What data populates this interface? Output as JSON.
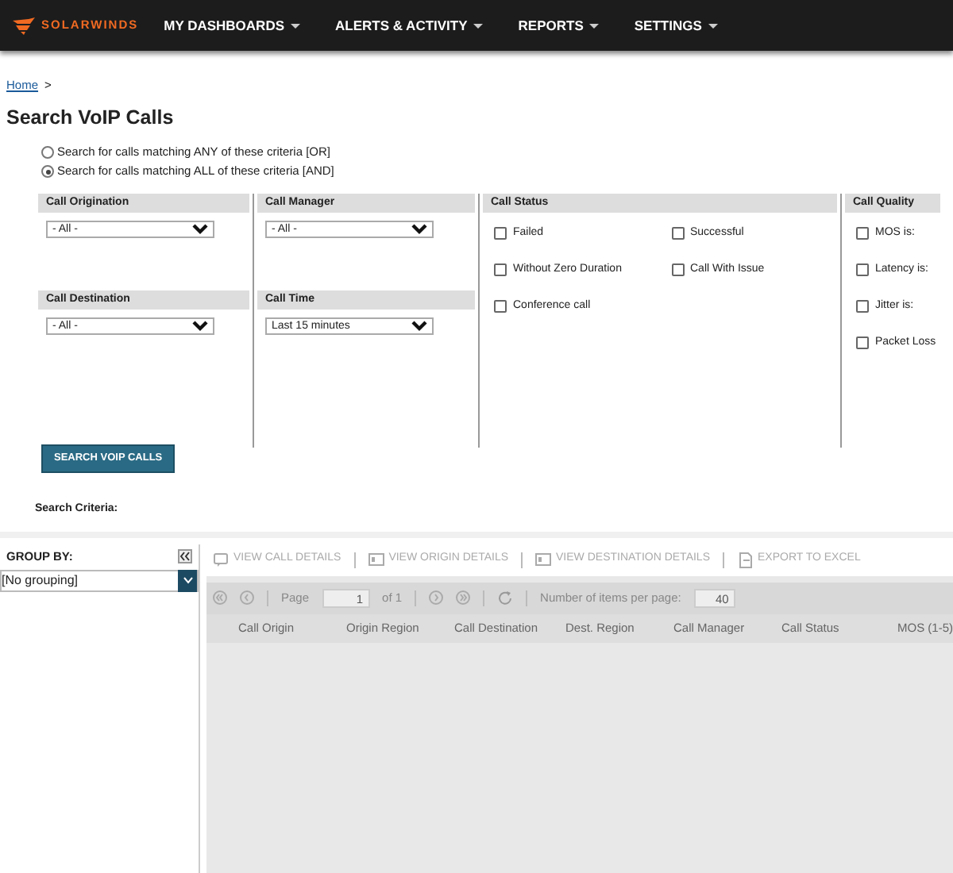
{
  "nav": {
    "logo": "SOLARWINDS",
    "items": [
      {
        "label": "MY DASHBOARDS"
      },
      {
        "label": "ALERTS & ACTIVITY"
      },
      {
        "label": "REPORTS"
      },
      {
        "label": "SETTINGS"
      }
    ]
  },
  "breadcrumb": {
    "link": "Home",
    "separator": ">"
  },
  "title": "Search VoIP Calls",
  "match_mode": [
    {
      "label": "Search for calls matching ANY of these criteria [OR]",
      "selected": false
    },
    {
      "label": "Search for calls matching ALL of these criteria [AND]",
      "selected": true
    }
  ],
  "criteria": [
    {
      "kind": "selects",
      "fields": [
        {
          "label": "Call Origination",
          "value": "- All -"
        },
        {
          "label": "Call Destination",
          "value": "- All -"
        }
      ]
    },
    {
      "kind": "selects",
      "fields": [
        {
          "label": "Call Manager",
          "value": "- All -"
        },
        {
          "label": "Call Time",
          "value": "Last 15 minutes"
        }
      ]
    },
    {
      "kind": "checks",
      "title": "Call Status",
      "items": [
        {
          "label": "Failed",
          "checked": false
        },
        {
          "label": "Successful",
          "checked": false
        },
        {
          "label": "Without Zero Duration",
          "checked": false
        },
        {
          "label": "Call With Issue",
          "checked": false
        },
        {
          "label": "Conference call",
          "checked": false
        }
      ]
    },
    {
      "kind": "checks",
      "title": "Call Quality",
      "items": [
        {
          "label": "MOS is:",
          "checked": false
        },
        {
          "label": "Latency is:",
          "checked": false
        },
        {
          "label": "Jitter is:",
          "checked": false
        },
        {
          "label": "Packet Loss",
          "checked": false
        }
      ]
    }
  ],
  "search_button": "SEARCH VOIP CALLS",
  "search_criteria_label": "Search Criteria:",
  "group_by": {
    "label": "GROUP BY:",
    "value": "[No grouping]"
  },
  "toolbar": [
    {
      "kind": "details",
      "label": "VIEW CALL DETAILS",
      "disabled": true
    },
    {
      "kind": "origin",
      "label": "VIEW ORIGIN DETAILS",
      "disabled": true
    },
    {
      "kind": "destination",
      "label": "VIEW DESTINATION DETAILS",
      "disabled": true
    },
    {
      "kind": "export",
      "label": "EXPORT TO EXCEL",
      "disabled": true
    }
  ],
  "pager": {
    "page_label": "Page",
    "page_value": "1",
    "of": "of 1",
    "per_page_label": "Number of items per page:",
    "per_page_value": "40"
  },
  "columns": [
    "Call Origin",
    "Origin Region",
    "Call Destination",
    "Dest. Region",
    "Call Manager",
    "Call Status",
    "MOS (1-5)"
  ]
}
